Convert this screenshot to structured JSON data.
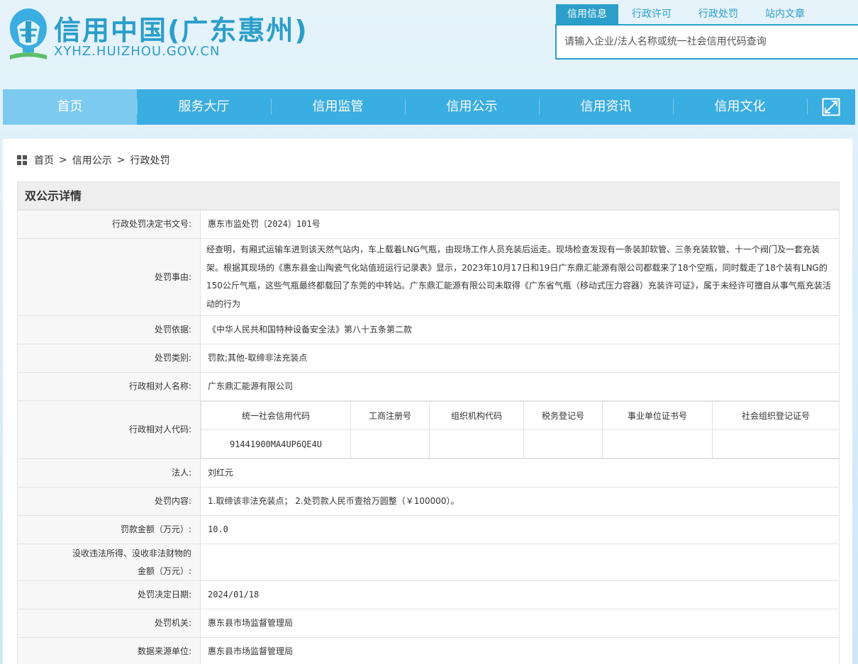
{
  "header": {
    "title": "信用中国(广东惠州)",
    "url": "XYHZ.HUIZHOU.GOV.CN"
  },
  "search": {
    "tabs": [
      "信用信息",
      "行政许可",
      "行政处罚",
      "站内文章"
    ],
    "placeholder": "请输入企业/法人名称或统一社会信用代码查询"
  },
  "nav": {
    "items": [
      "首页",
      "服务大厅",
      "信用监管",
      "信用公示",
      "信用资讯",
      "信用文化"
    ],
    "expand_icon": "expand-icon"
  },
  "breadcrumb": {
    "icon": "grid-icon",
    "items": [
      "首页",
      "信用公示",
      "行政处罚"
    ],
    "separator": ">"
  },
  "panel": {
    "title": "双公示详情"
  },
  "detail": {
    "doc_no": {
      "label": "行政处罚决定书文号:",
      "value": "惠东市监处罚〔2024〕101号"
    },
    "reason": {
      "label": "处罚事由:",
      "value": "经查明，有厢式运输车进到该天然气站内，车上载着LNG气瓶，由现场工作人员充装后运走。现场检查发现有一条装卸软管、三条充装软管、十一个阀门及一套充装架。根据其现场的《惠东县金山陶瓷气化站值班运行记录表》显示，2023年10月17日和19日广东鼎汇能源有限公司都载来了18个空瓶，同时载走了18个装有LNG的150公斤气瓶，这些气瓶最终都载回了东莞的中转站。广东鼎汇能源有限公司未取得《广东省气瓶（移动式压力容器）充装许可证》，属于未经许可擅自从事气瓶充装活动的行为"
    },
    "basis": {
      "label": "处罚依据:",
      "value": "《中华人民共和国特种设备安全法》第八十五条第二款"
    },
    "category": {
      "label": "处罚类别:",
      "value": "罚款;其他-取缔非法充装点"
    },
    "party_name": {
      "label": "行政相对人名称:",
      "value": "广东鼎汇能源有限公司"
    },
    "party_code": {
      "label": "行政相对人代码:",
      "headers": [
        "统一社会信用代码",
        "工商注册号",
        "组织机构代码",
        "税务登记号",
        "事业单位证书号",
        "社会组织登记证号"
      ],
      "values": [
        "91441900MA4UP6QE4U",
        "",
        "",
        "",
        "",
        ""
      ]
    },
    "legal_person": {
      "label": "法人:",
      "value": "刘红元"
    },
    "content": {
      "label": "处罚内容:",
      "value": "1.取缔该非法充装点； 2.处罚款人民币壹拾万圆整（￥100000）。"
    },
    "fine": {
      "label": "罚款金额（万元）:",
      "value": "10.0"
    },
    "confiscation": {
      "label_line1": "没收违法所得、没收非法财物的",
      "label_line2": "金额（万元）:",
      "value": ""
    },
    "date": {
      "label": "处罚决定日期:",
      "value": "2024/01/18"
    },
    "authority": {
      "label": "处罚机关:",
      "value": "惠东县市场监督管理局"
    },
    "source": {
      "label": "数据来源单位:",
      "value": "惠东县市场监督管理局"
    }
  },
  "colors": {
    "brand": "#2b9ec9",
    "nav_bg": "#3aade1",
    "nav_active": "#7ccaef",
    "label_bg": "#f7f7f7",
    "border": "#e3e3e3"
  }
}
